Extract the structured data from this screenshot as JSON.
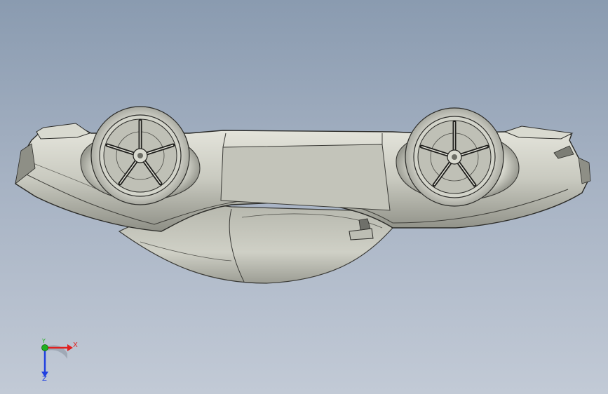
{
  "viewport": {
    "background_top": "#8a9bb0",
    "background_bottom": "#c2cad6"
  },
  "model": {
    "name": "car-body-upside-down",
    "body_color": "#c9cac0",
    "shadow_color": "#7f8078",
    "edge_color": "#2b2b28"
  },
  "triad": {
    "x_label": "X",
    "y_label": "Y",
    "z_label": "Z",
    "x_color": "#e02020",
    "y_color": "#20b020",
    "z_color": "#2040e0"
  }
}
